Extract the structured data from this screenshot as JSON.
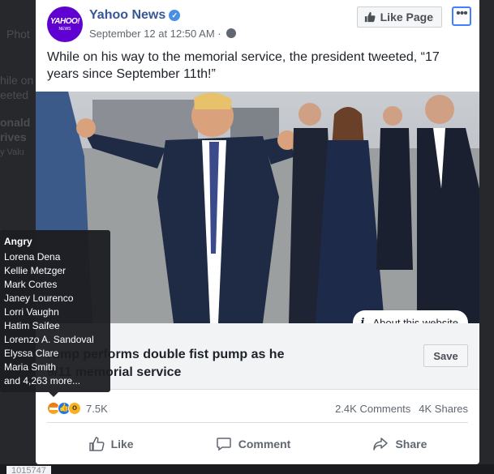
{
  "background": {
    "snippets": [
      "Phot",
      "hile on",
      "eeted",
      "onald",
      "rives",
      "y Valu"
    ],
    "footer": "1015747"
  },
  "post": {
    "page_name": "Yahoo News",
    "avatar_logo": "YAHOO!",
    "avatar_sub": "NEWS",
    "timestamp": "September 12 at 12:50 AM",
    "like_page_label": "Like Page",
    "text": "While on his way to the memorial service, the president tweeted, “17 years since September 11th!”",
    "about_website_label": "About this website",
    "link": {
      "domain": "",
      "title": "rump performs double fist pump as he\n9/11 memorial service",
      "save_label": "Save"
    },
    "stats": {
      "reaction_count": "7.5K",
      "comments": "2.4K Comments",
      "shares": "4K Shares"
    },
    "actions": {
      "like": "Like",
      "comment": "Comment",
      "share": "Share"
    }
  },
  "tooltip": {
    "heading": "Angry",
    "names": [
      "Lorena Dena",
      "Kellie Metzger",
      "Mark Cortes",
      "Janey Lourenco",
      "Lorri Vaughn",
      "Hatim Saifee",
      "Lorenzo A. Sandoval",
      "Elyssa Clare",
      "Maria Smith"
    ],
    "more": "and 4,263 more..."
  },
  "colors": {
    "brand_blue": "#365899",
    "yahoo_purple": "#5f01d1",
    "link_blue": "#4080ff"
  }
}
